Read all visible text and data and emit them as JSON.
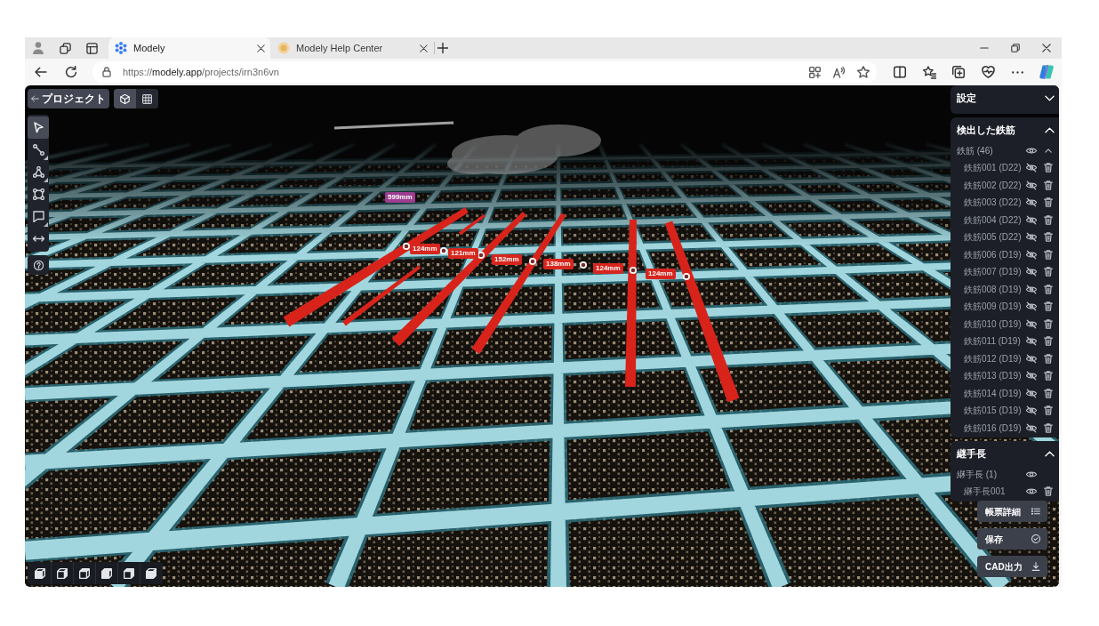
{
  "browser": {
    "tabs": [
      {
        "title": "Modely",
        "selected": true
      },
      {
        "title": "Modely Help Center",
        "selected": false
      }
    ],
    "url": {
      "scheme": "https://",
      "host": "modely.app",
      "path": "/projects/irn3n6vn"
    }
  },
  "app": {
    "back_button": {
      "label": "プロジェクト"
    },
    "view_modes": [
      {
        "kind": "cube",
        "selected": true
      },
      {
        "kind": "grid",
        "selected": false
      }
    ],
    "tools": [
      {
        "kind": "select",
        "selected": true,
        "submenu": false
      },
      {
        "kind": "polyline",
        "selected": false,
        "submenu": true
      },
      {
        "kind": "triangle",
        "selected": false,
        "submenu": true
      },
      {
        "kind": "nodes",
        "selected": false,
        "submenu": false
      },
      {
        "kind": "comment",
        "selected": false,
        "submenu": true
      },
      {
        "kind": "measure",
        "selected": false,
        "submenu": false
      }
    ],
    "measurements": [
      {
        "label": "599mm",
        "color": "#9c3d8f"
      },
      {
        "label": "124mm",
        "color": "#d7261e"
      },
      {
        "label": "121mm",
        "color": "#d7261e"
      },
      {
        "label": "152mm",
        "color": "#d7261e"
      },
      {
        "label": "138mm",
        "color": "#d7261e"
      },
      {
        "label": "124mm",
        "color": "#d7261e"
      },
      {
        "label": "124mm",
        "color": "#d7261e"
      }
    ],
    "panel": {
      "sections": [
        {
          "title": "設定",
          "expanded": false
        },
        {
          "title": "検出した鉄筋",
          "expanded": true,
          "group": {
            "label": "鉄筋 (46)",
            "visible": true,
            "expanded": true
          },
          "items": [
            {
              "label": "鉄筋001 (D22)",
              "visible": false
            },
            {
              "label": "鉄筋002 (D22)",
              "visible": false
            },
            {
              "label": "鉄筋003 (D22)",
              "visible": false
            },
            {
              "label": "鉄筋004 (D22)",
              "visible": false
            },
            {
              "label": "鉄筋005 (D22)",
              "visible": false
            },
            {
              "label": "鉄筋006 (D19)",
              "visible": false
            },
            {
              "label": "鉄筋007 (D19)",
              "visible": false
            },
            {
              "label": "鉄筋008 (D19)",
              "visible": false
            },
            {
              "label": "鉄筋009 (D19)",
              "visible": false
            },
            {
              "label": "鉄筋010 (D19)",
              "visible": false
            },
            {
              "label": "鉄筋011 (D19)",
              "visible": false
            },
            {
              "label": "鉄筋012 (D19)",
              "visible": false
            },
            {
              "label": "鉄筋013 (D19)",
              "visible": false
            },
            {
              "label": "鉄筋014 (D19)",
              "visible": false
            },
            {
              "label": "鉄筋015 (D19)",
              "visible": false
            },
            {
              "label": "鉄筋016 (D19)",
              "visible": false
            }
          ]
        },
        {
          "title": "継手長",
          "expanded": true,
          "group": {
            "label": "継手長 (1)",
            "visible": true
          },
          "items": [
            {
              "label": "継手長001",
              "visible": true
            }
          ]
        }
      ]
    },
    "actions": [
      {
        "label": "帳票詳細",
        "kind": "report"
      },
      {
        "label": "保存",
        "kind": "save"
      },
      {
        "label": "CAD出力",
        "kind": "export"
      }
    ]
  }
}
